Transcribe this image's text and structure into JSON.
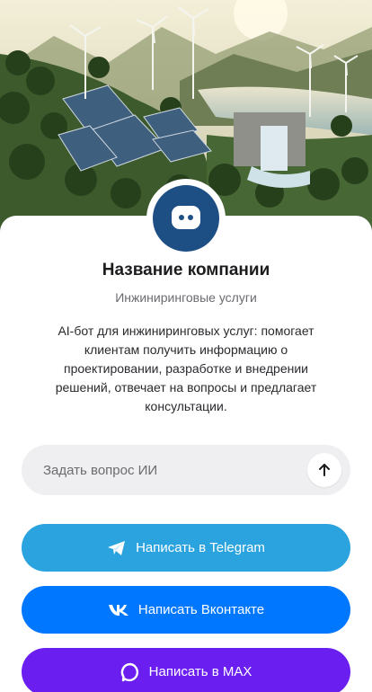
{
  "profile": {
    "name": "Название компании",
    "category": "Инжиниринговые услуги",
    "description": "AI-бот для инжиниринговых услуг: помогает клиентам получить информацию о проектировании, разработке и внедрении решений, отвечает на вопросы и предлагает консультации."
  },
  "ask": {
    "placeholder": "Задать вопрос ИИ",
    "send_icon": "arrow-up-icon"
  },
  "buttons": {
    "telegram": {
      "label": "Написать в Telegram",
      "icon": "telegram-icon",
      "color": "#2aa3df"
    },
    "vk": {
      "label": "Написать Вконтакте",
      "icon": "vk-icon",
      "color": "#0077ff"
    },
    "max": {
      "label": "Написать в MAX",
      "icon": "max-icon",
      "color": "#6a1ff0"
    }
  },
  "colors": {
    "avatar_bg": "#1d4f85"
  }
}
